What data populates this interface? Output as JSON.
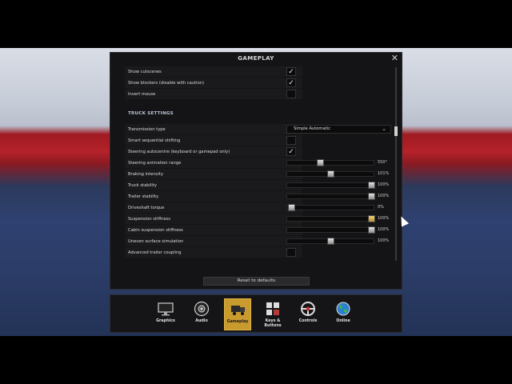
{
  "dialog": {
    "title": "GAMEPLAY",
    "close_icon": "close-icon",
    "reset_label": "Reset to defaults"
  },
  "settings": {
    "show_cutscenes": {
      "label": "Show cutscenes",
      "checked": true
    },
    "show_blockers": {
      "label": "Show blockers (disable with caution)",
      "checked": true
    },
    "invert_mouse": {
      "label": "Invert mouse",
      "checked": false
    },
    "truck_section": "TRUCK SETTINGS",
    "transmission": {
      "label": "Transmission type",
      "value": "Simple Automatic"
    },
    "smart_shifting": {
      "label": "Smart sequential shifting",
      "checked": false
    },
    "steering_autocentre": {
      "label": "Steering autocentre (keyboard or gamepad only)",
      "checked": true
    },
    "steering_range": {
      "label": "Steering animation range",
      "value_text": "550°",
      "level": 0.38
    },
    "braking": {
      "label": "Braking intensity",
      "value_text": "101%",
      "level": 0.5
    },
    "truck_stability": {
      "label": "Truck stability",
      "value_text": "100%",
      "level": 0.97
    },
    "trailer_stability": {
      "label": "Trailer stability",
      "value_text": "100%",
      "level": 0.97
    },
    "driveshaft": {
      "label": "Driveshaft torque",
      "value_text": "0%",
      "level": 0.05
    },
    "suspension": {
      "label": "Suspension stiffness",
      "value_text": "100%",
      "level": 0.97
    },
    "cabin_suspension": {
      "label": "Cabin suspension stiffness",
      "value_text": "100%",
      "level": 0.97
    },
    "uneven_surface": {
      "label": "Uneven surface simulation",
      "value_text": "100%",
      "level": 0.5
    },
    "trailer_coupling": {
      "label": "Advanced trailer coupling",
      "checked": false
    }
  },
  "tabs": [
    {
      "label": "Graphics",
      "icon": "monitor-icon"
    },
    {
      "label": "Audio",
      "icon": "speaker-icon"
    },
    {
      "label": "Gameplay",
      "icon": "truck-icon",
      "active": true
    },
    {
      "label": "Keys &",
      "label2": "Buttons",
      "icon": "keyboard-icon"
    },
    {
      "label": "Controls",
      "icon": "steering-wheel-icon"
    },
    {
      "label": "Online",
      "icon": "globe-icon"
    }
  ],
  "colors": {
    "accent": "#c99a2e",
    "panel": "#141416"
  }
}
